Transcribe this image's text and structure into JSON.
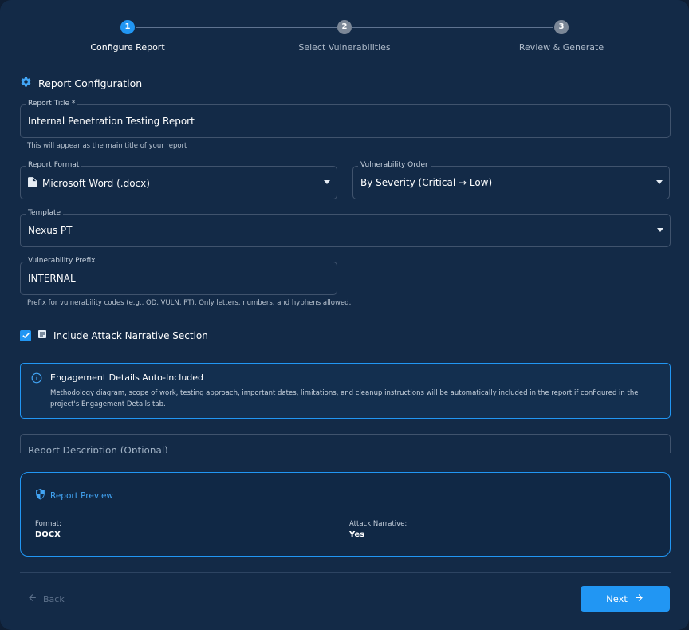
{
  "stepper": {
    "steps": [
      {
        "number": "1",
        "label": "Configure Report",
        "active": true
      },
      {
        "number": "2",
        "label": "Select Vulnerabilities",
        "active": false
      },
      {
        "number": "3",
        "label": "Review & Generate",
        "active": false
      }
    ]
  },
  "section": {
    "title": "Report Configuration",
    "icon": "gear-icon"
  },
  "fields": {
    "report_title": {
      "label": "Report Title *",
      "value": "Internal Penetration Testing Report",
      "helper": "This will appear as the main title of your report"
    },
    "report_format": {
      "label": "Report Format",
      "value": "Microsoft Word (.docx)",
      "icon": "document-icon"
    },
    "vulnerability_order": {
      "label": "Vulnerability Order",
      "value": "By Severity (Critical → Low)"
    },
    "template": {
      "label": "Template",
      "value": "Nexus PT"
    },
    "vulnerability_prefix": {
      "label": "Vulnerability Prefix",
      "value": "INTERNAL",
      "helper": "Prefix for vulnerability codes (e.g., OD, VULN, PT). Only letters, numbers, and hyphens allowed."
    },
    "report_description": {
      "label": "Report Description (Optional)"
    }
  },
  "attack_narrative": {
    "label": "Include Attack Narrative Section",
    "checked": true
  },
  "info_alert": {
    "title": "Engagement Details Auto-Included",
    "text": "Methodology diagram, scope of work, testing approach, important dates, limitations, and cleanup instructions will be automatically included in the report if configured in the project's Engagement Details tab."
  },
  "preview": {
    "title": "Report Preview",
    "format_label": "Format:",
    "format_value": "DOCX",
    "narrative_label": "Attack Narrative:",
    "narrative_value": "Yes"
  },
  "footer": {
    "back_label": "Back",
    "next_label": "Next"
  },
  "colors": {
    "accent": "#2196f3",
    "background": "#132a47",
    "border": "#40536d"
  }
}
